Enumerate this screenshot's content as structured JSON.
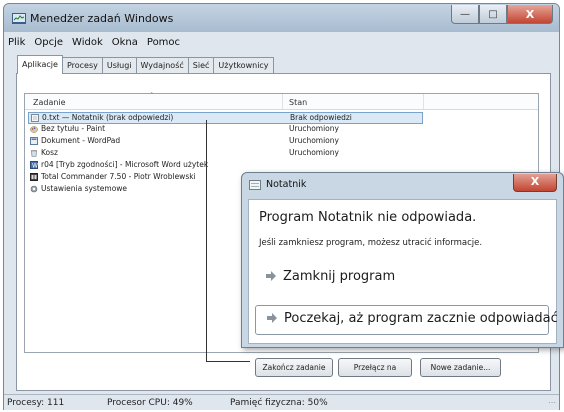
{
  "window": {
    "title": "Menedżer zadań Windows"
  },
  "menu": [
    "Plik",
    "Opcje",
    "Widok",
    "Okna",
    "Pomoc"
  ],
  "tabs": [
    "Aplikacje",
    "Procesy",
    "Usługi",
    "Wydajność",
    "Sieć",
    "Użytkownicy"
  ],
  "list": {
    "headers": {
      "task": "Zadanie",
      "state": "Stan"
    },
    "rows": [
      {
        "name": "0.txt — Notatnik (brak odpowiedzi)",
        "state": "Brak odpowiedzi",
        "icon": "notepad-icon"
      },
      {
        "name": "Bez tytułu - Paint",
        "state": "Uruchomiony",
        "icon": "paint-icon"
      },
      {
        "name": "Dokument - WordPad",
        "state": "Uruchomiony",
        "icon": "wordpad-icon"
      },
      {
        "name": "Kosz",
        "state": "Uruchomiony",
        "icon": "recycle-bin-icon"
      },
      {
        "name": "r04 [Tryb zgodności] - Microsoft Word użytek",
        "state": "",
        "icon": "word-icon"
      },
      {
        "name": "Total Commander 7.50 - Piotr Wroblewski",
        "state": "",
        "icon": "total-commander-icon"
      },
      {
        "name": "Ustawienia systemowe",
        "state": "",
        "icon": "settings-icon"
      }
    ]
  },
  "buttons": {
    "end_task": "Zakończ zadanie",
    "switch_to": "Przełącz na",
    "new_task": "Nowe zadanie..."
  },
  "status": {
    "processes": "Procesy: 111",
    "cpu": "Procesor CPU: 49%",
    "memory": "Pamięć fizyczna: 50%"
  },
  "dialog": {
    "title": "Notatnik",
    "heading": "Program Notatnik nie odpowiada.",
    "info": "Jeśli zamkniesz program, możesz utracić informacje.",
    "close_program": "Zamknij program",
    "wait": "Poczekaj, aż program zacznie odpowiadać"
  },
  "colors": {
    "selection": "#dbe9f6",
    "close_button": "#c24532",
    "window_chrome": "#c3d3e3"
  }
}
